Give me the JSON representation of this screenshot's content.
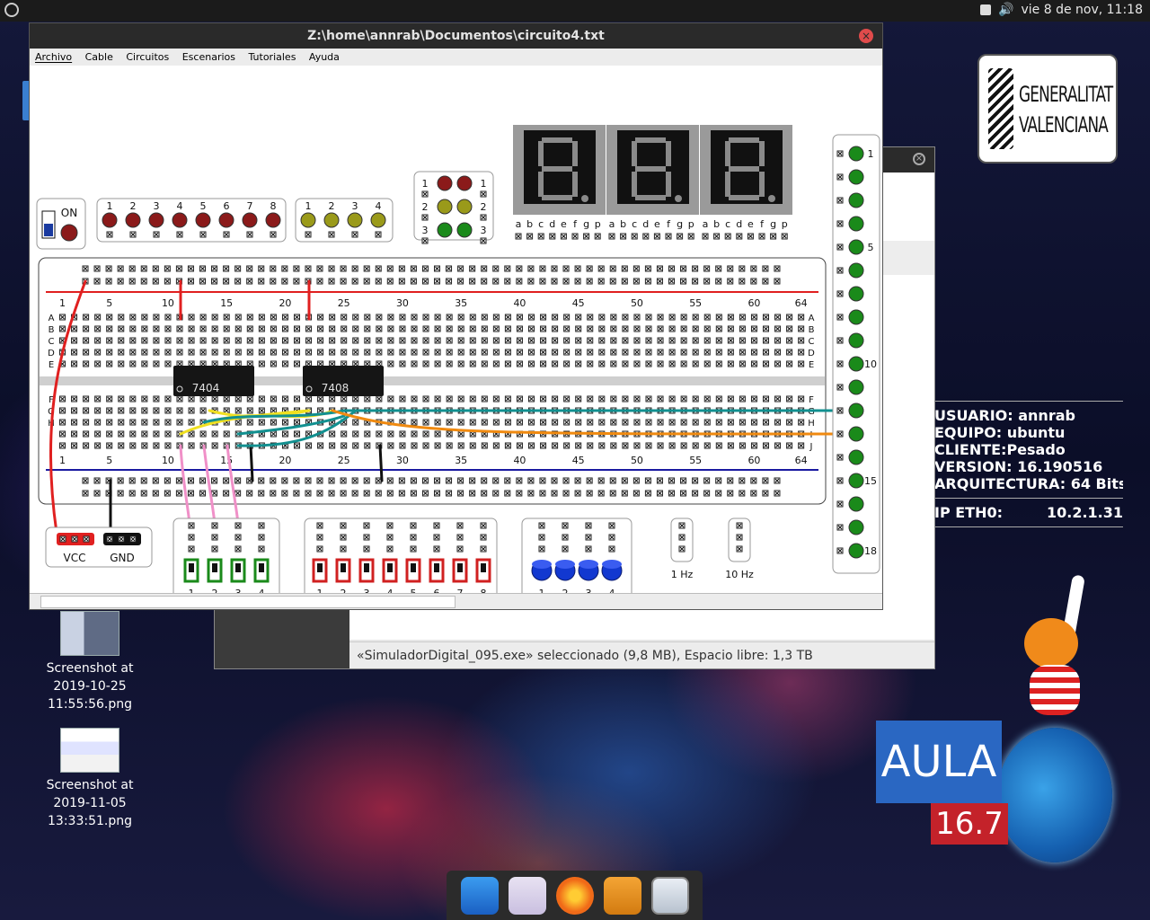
{
  "topbar": {
    "datetime": "vie  8 de nov, 11:18"
  },
  "desktop_icons": [
    {
      "label_lines": [
        "Screenshot at",
        "2019-10-25",
        "11:55:56.png"
      ]
    },
    {
      "label_lines": [
        "Screenshot at",
        "2019-11-05",
        "13:33:51.png"
      ]
    }
  ],
  "gva": {
    "line1": "GENERALITAT",
    "line2": "VALENCIANA"
  },
  "info": {
    "usuario": "USUARIO: annrab",
    "equipo": "EQUIPO: ubuntu",
    "cliente": "CLIENTE:Pesado",
    "version": "VERSION: 16.190516",
    "arquitectura": "ARQUITECTURA: 64 Bits",
    "eth_label": "IP ETH0:",
    "eth_value": "10.2.1.31"
  },
  "aula": {
    "name": "AULA",
    "version": "16.7"
  },
  "file_manager": {
    "status": "«SimuladorDigital_095.exe» seleccionado (9,8 MB), Espacio libre: 1,3 TB"
  },
  "window": {
    "title": "Z:\\home\\annrab\\Documentos\\circuito4.txt",
    "menu": [
      "Archivo",
      "Cable",
      "Circuitos",
      "Escenarios",
      "Tutoriales",
      "Ayuda"
    ]
  },
  "sim": {
    "switch_label": "ON",
    "red_leds": [
      "1",
      "2",
      "3",
      "4",
      "5",
      "6",
      "7",
      "8"
    ],
    "yellow_leds": [
      "1",
      "2",
      "3",
      "4"
    ],
    "traffic_rows": [
      "1",
      "2",
      "3"
    ],
    "seg_labels": [
      "a",
      "b",
      "c",
      "d",
      "e",
      "f",
      "g",
      "p"
    ],
    "col_numbers": [
      "1",
      "5",
      "10",
      "15",
      "20",
      "25",
      "30",
      "35",
      "40",
      "45",
      "50",
      "55",
      "60",
      "64"
    ],
    "row_letters_top": [
      "A",
      "B",
      "C",
      "D",
      "E"
    ],
    "row_letters_bottom": [
      "F",
      "G",
      "H",
      "I",
      "J"
    ],
    "chips": [
      "7404",
      "7408"
    ],
    "vcc": "VCC",
    "gnd": "GND",
    "green_switches": [
      "1",
      "2",
      "3",
      "4"
    ],
    "red_switches": [
      "1",
      "2",
      "3",
      "4",
      "5",
      "6",
      "7",
      "8"
    ],
    "buttons": [
      "1",
      "2",
      "3",
      "4"
    ],
    "clock1": "1 Hz",
    "clock2": "10 Hz",
    "right_leds_labels": {
      "1": "1",
      "5": "5",
      "10": "10",
      "15": "15",
      "18": "18"
    }
  },
  "colors": {
    "red_led": "#8b1a1a",
    "yellow_led": "#9a9a1a",
    "green_led": "#1a8a1a",
    "rail_red": "#e02020",
    "rail_blue": "#1a1aa0"
  }
}
